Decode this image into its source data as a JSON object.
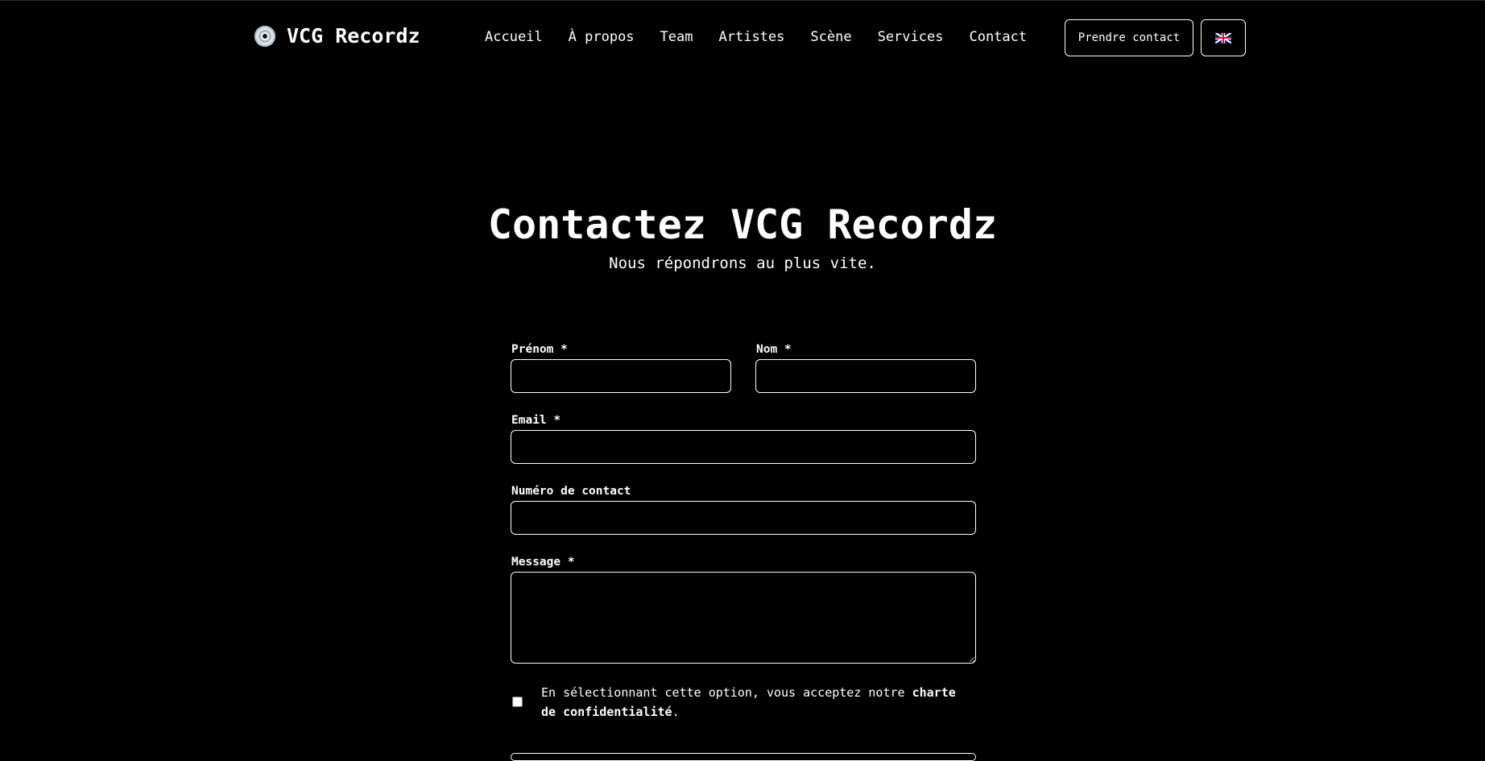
{
  "header": {
    "logo_text": "VCG Recordz",
    "logo_icon": "disc-icon",
    "nav": [
      {
        "label": "Accueil"
      },
      {
        "label": "À propos"
      },
      {
        "label": "Team"
      },
      {
        "label": "Artistes"
      },
      {
        "label": "Scène"
      },
      {
        "label": "Services"
      },
      {
        "label": "Contact"
      }
    ],
    "cta_label": "Prendre contact",
    "language_icon": "uk-flag-icon"
  },
  "main": {
    "title": "Contactez VCG Recordz",
    "subtitle": "Nous répondrons au plus vite."
  },
  "form": {
    "first_name_label": "Prénom *",
    "first_name_value": "",
    "last_name_label": "Nom *",
    "last_name_value": "",
    "email_label": "Email *",
    "email_value": "",
    "phone_label": "Numéro de contact",
    "phone_value": "",
    "message_label": "Message *",
    "message_value": "",
    "consent_checked": false,
    "consent_text_before": "En sélectionnant cette option, vous acceptez notre ",
    "consent_link": "charte de confidentialité",
    "consent_text_after": "."
  }
}
